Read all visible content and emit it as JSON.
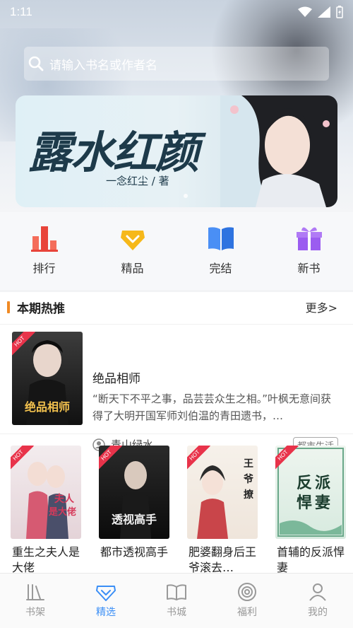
{
  "status": {
    "time": "1:11"
  },
  "search": {
    "placeholder": "请输入书名或作者名"
  },
  "banner": {
    "title": "露水红颜",
    "author": "一念红尘 / 著"
  },
  "categories": [
    {
      "label": "排行",
      "icon": "ranking-icon"
    },
    {
      "label": "精品",
      "icon": "premium-icon"
    },
    {
      "label": "完结",
      "icon": "finished-book-icon"
    },
    {
      "label": "新书",
      "icon": "new-book-gift-icon"
    }
  ],
  "hot": {
    "title": "本期热推",
    "more": "更多>",
    "badge": "HOT",
    "featured": {
      "title": "绝品相师",
      "description": "“断天下不平之事，品芸芸众生之相。”叶枫无意间获得了大明开国军师刘伯温的青田遗书，…",
      "author": "青山绿水",
      "tag": "都市生活"
    },
    "books": [
      {
        "title": "重生之夫人是大佬"
      },
      {
        "title": "都市透视高手"
      },
      {
        "title": "肥婆翻身后王爷滚去…"
      },
      {
        "title": "首辅的反派悍妻"
      }
    ]
  },
  "nav": {
    "items": [
      {
        "label": "书架",
        "active": false
      },
      {
        "label": "精选",
        "active": true
      },
      {
        "label": "书城",
        "active": false
      },
      {
        "label": "福利",
        "active": false
      },
      {
        "label": "我的",
        "active": false
      }
    ]
  },
  "colors": {
    "accent": "#3a8ef6",
    "hot": "#e8334a",
    "section_bar": "#f08a24"
  }
}
